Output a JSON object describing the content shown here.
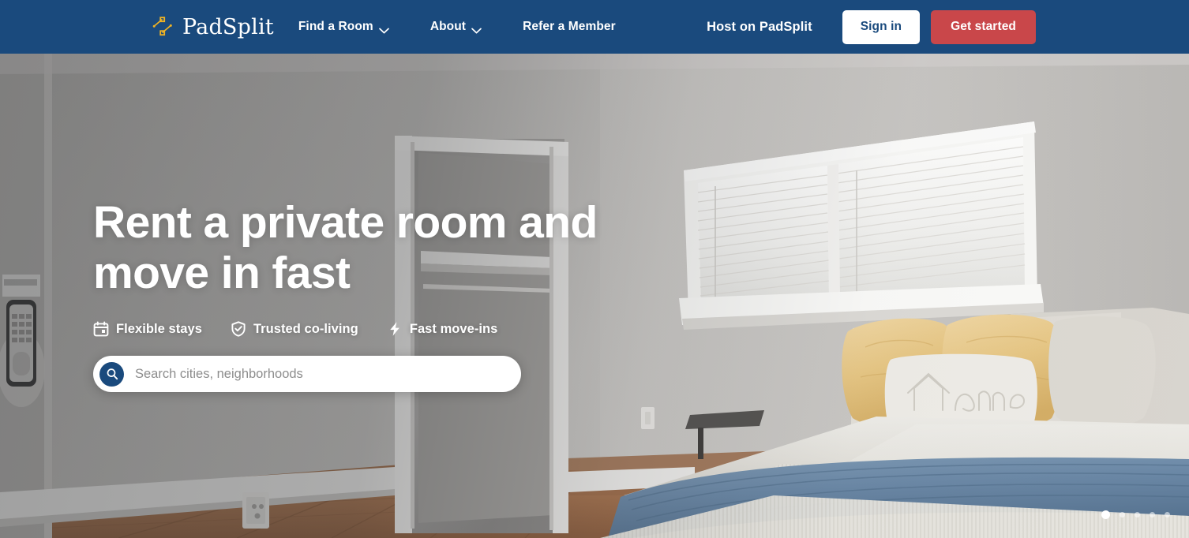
{
  "brand": {
    "name": "PadSplit",
    "logo_icon": "padsplit-nodes-icon",
    "logo_color": "#f0b323"
  },
  "colors": {
    "navy": "#1a4a7d",
    "red": "#c9474a",
    "white": "#ffffff"
  },
  "nav": {
    "links": [
      {
        "label": "Find a Room",
        "has_dropdown": true,
        "icon": "chevron-down-icon"
      },
      {
        "label": "About",
        "has_dropdown": true,
        "icon": "chevron-down-icon"
      },
      {
        "label": "Refer a Member",
        "has_dropdown": false,
        "icon": ""
      }
    ],
    "host_link": "Host on PadSplit",
    "signin_label": "Sign in",
    "getstarted_label": "Get started"
  },
  "hero": {
    "title_line1": "Rent a private room and",
    "title_line2": "move in fast",
    "badges": [
      {
        "label": "Flexible stays",
        "icon": "calendar-icon"
      },
      {
        "label": "Trusted co-living",
        "icon": "shield-check-icon"
      },
      {
        "label": "Fast move-ins",
        "icon": "lightning-bolt-icon"
      }
    ],
    "search": {
      "placeholder": "Search cities, neighborhoods",
      "value": "",
      "icon": "search-icon"
    },
    "carousel": {
      "total": 5,
      "active_index": 0
    }
  }
}
